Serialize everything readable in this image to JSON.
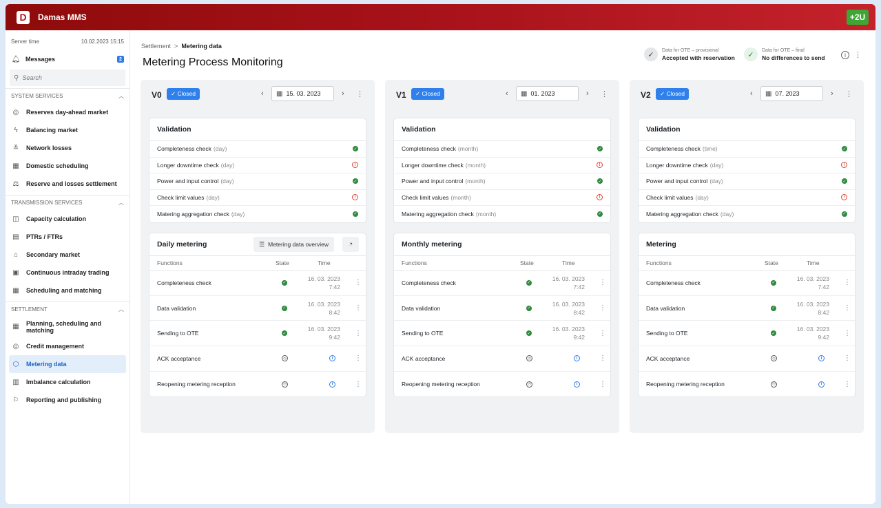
{
  "app": {
    "logo": "D",
    "title": "Damas MMS",
    "brand_button": "+2U"
  },
  "sidebar": {
    "server_label": "Server time",
    "server_time": "10.02.2023 15:15",
    "messages_label": "Messages",
    "messages_count": "2",
    "search_placeholder": "Search",
    "sections": [
      {
        "title": "SYSTEM SERVICES",
        "items": [
          "Reserves day-ahead market",
          "Balancing market",
          "Network losses",
          "Domestic scheduling",
          "Reserve and losses settlement"
        ]
      },
      {
        "title": "TRANSMISSION SERVICES",
        "items": [
          "Capacity calculation",
          "PTRs / FTRs",
          "Secondary market",
          "Continuous intraday trading",
          "Scheduling and matching"
        ]
      },
      {
        "title": "SETTLEMENT",
        "items": [
          "Planning, scheduling and matching",
          "Credit management",
          "Metering data",
          "Imbalance calculation",
          "Reporting and publishing"
        ]
      }
    ]
  },
  "header": {
    "breadcrumb_parent": "Settlement",
    "breadcrumb_current": "Metering data",
    "title": "Metering Process Monitoring",
    "status_provisional_label": "Data for OTE – provisional",
    "status_provisional_value": "Accepted with reservation",
    "status_final_label": "Data for OTE – final",
    "status_final_value": "No differences to send"
  },
  "columns": [
    {
      "version": "V0",
      "badge": "✓ Closed",
      "date": "15. 03. 2023",
      "validation_title": "Validation",
      "validation": [
        {
          "name": "Completeness check",
          "period": "(day)",
          "status": "ok"
        },
        {
          "name": "Longer downtime check",
          "period": "(day)",
          "status": "error"
        },
        {
          "name": "Power and input control",
          "period": "(day)",
          "status": "ok"
        },
        {
          "name": "Check limit values",
          "period": "(day)",
          "status": "error"
        },
        {
          "name": "Matering aggregation check",
          "period": "(day)",
          "status": "ok"
        }
      ],
      "metering_title": "Daily metering",
      "overview_button": "Metering data overview",
      "headers": {
        "functions": "Functions",
        "state": "State",
        "time": "Time"
      },
      "functions": [
        {
          "name": "Completeness check",
          "state": "ok",
          "date": "16. 03. 2023",
          "time": "7:42"
        },
        {
          "name": "Data validation",
          "state": "ok",
          "date": "16. 03. 2023",
          "time": "8:42"
        },
        {
          "name": "Sending to OTE",
          "state": "ok",
          "date": "16. 03. 2023",
          "time": "9:42"
        },
        {
          "name": "ACK acceptance",
          "state": "pending",
          "date": "",
          "time": ""
        },
        {
          "name": "Reopening metering reception",
          "state": "pending",
          "date": "",
          "time": ""
        }
      ]
    },
    {
      "version": "V1",
      "badge": "✓ Closed",
      "date": "01. 2023",
      "validation_title": "Validation",
      "validation": [
        {
          "name": "Completeness check",
          "period": "(month)",
          "status": "ok"
        },
        {
          "name": "Longer downtime check",
          "period": "(month)",
          "status": "error"
        },
        {
          "name": "Power and input control",
          "period": "(month)",
          "status": "ok"
        },
        {
          "name": "Check limit values",
          "period": "(month)",
          "status": "error"
        },
        {
          "name": "Matering aggregation check",
          "period": "(month)",
          "status": "ok"
        }
      ],
      "metering_title": "Monthly metering",
      "overview_button": "",
      "headers": {
        "functions": "Functions",
        "state": "State",
        "time": "Time"
      },
      "functions": [
        {
          "name": "Completeness check",
          "state": "ok",
          "date": "16. 03. 2023",
          "time": "7:42"
        },
        {
          "name": "Data validation",
          "state": "ok",
          "date": "16. 03. 2023",
          "time": "8:42"
        },
        {
          "name": "Sending to OTE",
          "state": "ok",
          "date": "16. 03. 2023",
          "time": "9:42"
        },
        {
          "name": "ACK acceptance",
          "state": "pending",
          "date": "",
          "time": ""
        },
        {
          "name": "Reopening metering reception",
          "state": "pending",
          "date": "",
          "time": ""
        }
      ]
    },
    {
      "version": "V2",
      "badge": "✓ Closed",
      "date": "07. 2023",
      "validation_title": "Validation",
      "validation": [
        {
          "name": "Completeness check",
          "period": "(time)",
          "status": "ok"
        },
        {
          "name": "Longer downtime check",
          "period": "(day)",
          "status": "error"
        },
        {
          "name": "Power and input control",
          "period": "(day)",
          "status": "ok"
        },
        {
          "name": "Check limit values",
          "period": "(day)",
          "status": "error"
        },
        {
          "name": "Matering aggregation check",
          "period": "(day)",
          "status": "ok"
        }
      ],
      "metering_title": "Metering",
      "overview_button": "",
      "headers": {
        "functions": "Functions",
        "state": "State",
        "time": "Time"
      },
      "functions": [
        {
          "name": "Completeness check",
          "state": "ok",
          "date": "16. 03. 2023",
          "time": "7:42"
        },
        {
          "name": "Data validation",
          "state": "ok",
          "date": "16. 03. 2023",
          "time": "8:42"
        },
        {
          "name": "Sending to OTE",
          "state": "ok",
          "date": "16. 03. 2023",
          "time": "9:42"
        },
        {
          "name": "ACK acceptance",
          "state": "pending",
          "date": "",
          "time": ""
        },
        {
          "name": "Reopening metering reception",
          "state": "pending",
          "date": "",
          "time": ""
        }
      ]
    }
  ]
}
